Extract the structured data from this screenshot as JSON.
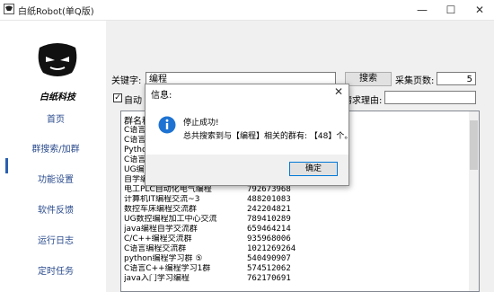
{
  "window": {
    "title": "白纸Robot(单Q版)",
    "min_glyph": "—",
    "max_glyph": "☐",
    "close_glyph": "✕"
  },
  "brand": {
    "logo_text": "白纸科技"
  },
  "sidebar": {
    "items": [
      {
        "label": "首页"
      },
      {
        "label": "群搜索/加群"
      },
      {
        "label": "功能设置"
      },
      {
        "label": "软件反馈"
      },
      {
        "label": "运行日志"
      },
      {
        "label": "定时任务"
      }
    ],
    "active_index": 1
  },
  "search": {
    "keyword_label": "关键字:",
    "keyword_value": "编程",
    "search_button": "搜索",
    "pages_label": "采集页数:",
    "pages_value": "5",
    "auto_label": "自动",
    "auto_checked": "✓",
    "reason_label": "请求理由:",
    "reason_value": ""
  },
  "list": {
    "header": "群名称",
    "rows": [
      {
        "name": "C语言",
        "id": ""
      },
      {
        "name": "C语言/",
        "id": ""
      },
      {
        "name": "Pytho",
        "id": ""
      },
      {
        "name": "C语言C",
        "id": ""
      },
      {
        "name": "UG编",
        "id": ""
      },
      {
        "name": "自学编",
        "id": ""
      },
      {
        "name": "电工PLC自动化电气编程",
        "id": "792673968"
      },
      {
        "name": "计算机IT编程交流~3",
        "id": "488201083"
      },
      {
        "name": "数控车床编程交流群",
        "id": "242204821"
      },
      {
        "name": "UG数控编程加工中心交流",
        "id": "789410289"
      },
      {
        "name": "java编程自学交流群",
        "id": "659464214"
      },
      {
        "name": "C/C++编程交流群",
        "id": "935968006"
      },
      {
        "name": "C语言编程交流群",
        "id": "1021269264"
      },
      {
        "name": "python编程学习群 ⑤",
        "id": "540490907"
      },
      {
        "name": "C语言C++编程学习1群",
        "id": "574512062"
      },
      {
        "name": "java入门学习编程",
        "id": "762170691"
      }
    ]
  },
  "dialog": {
    "title": "信息:",
    "line1": "停止成功!",
    "line2": "总共搜索到与【编程】相关的群有: 【48】个。",
    "ok_label": "确定",
    "close_glyph": "✕"
  },
  "colors": {
    "nav_text": "#2a4b8d",
    "active_bar": "#2a5fb0",
    "info_icon": "#1e73d2"
  }
}
